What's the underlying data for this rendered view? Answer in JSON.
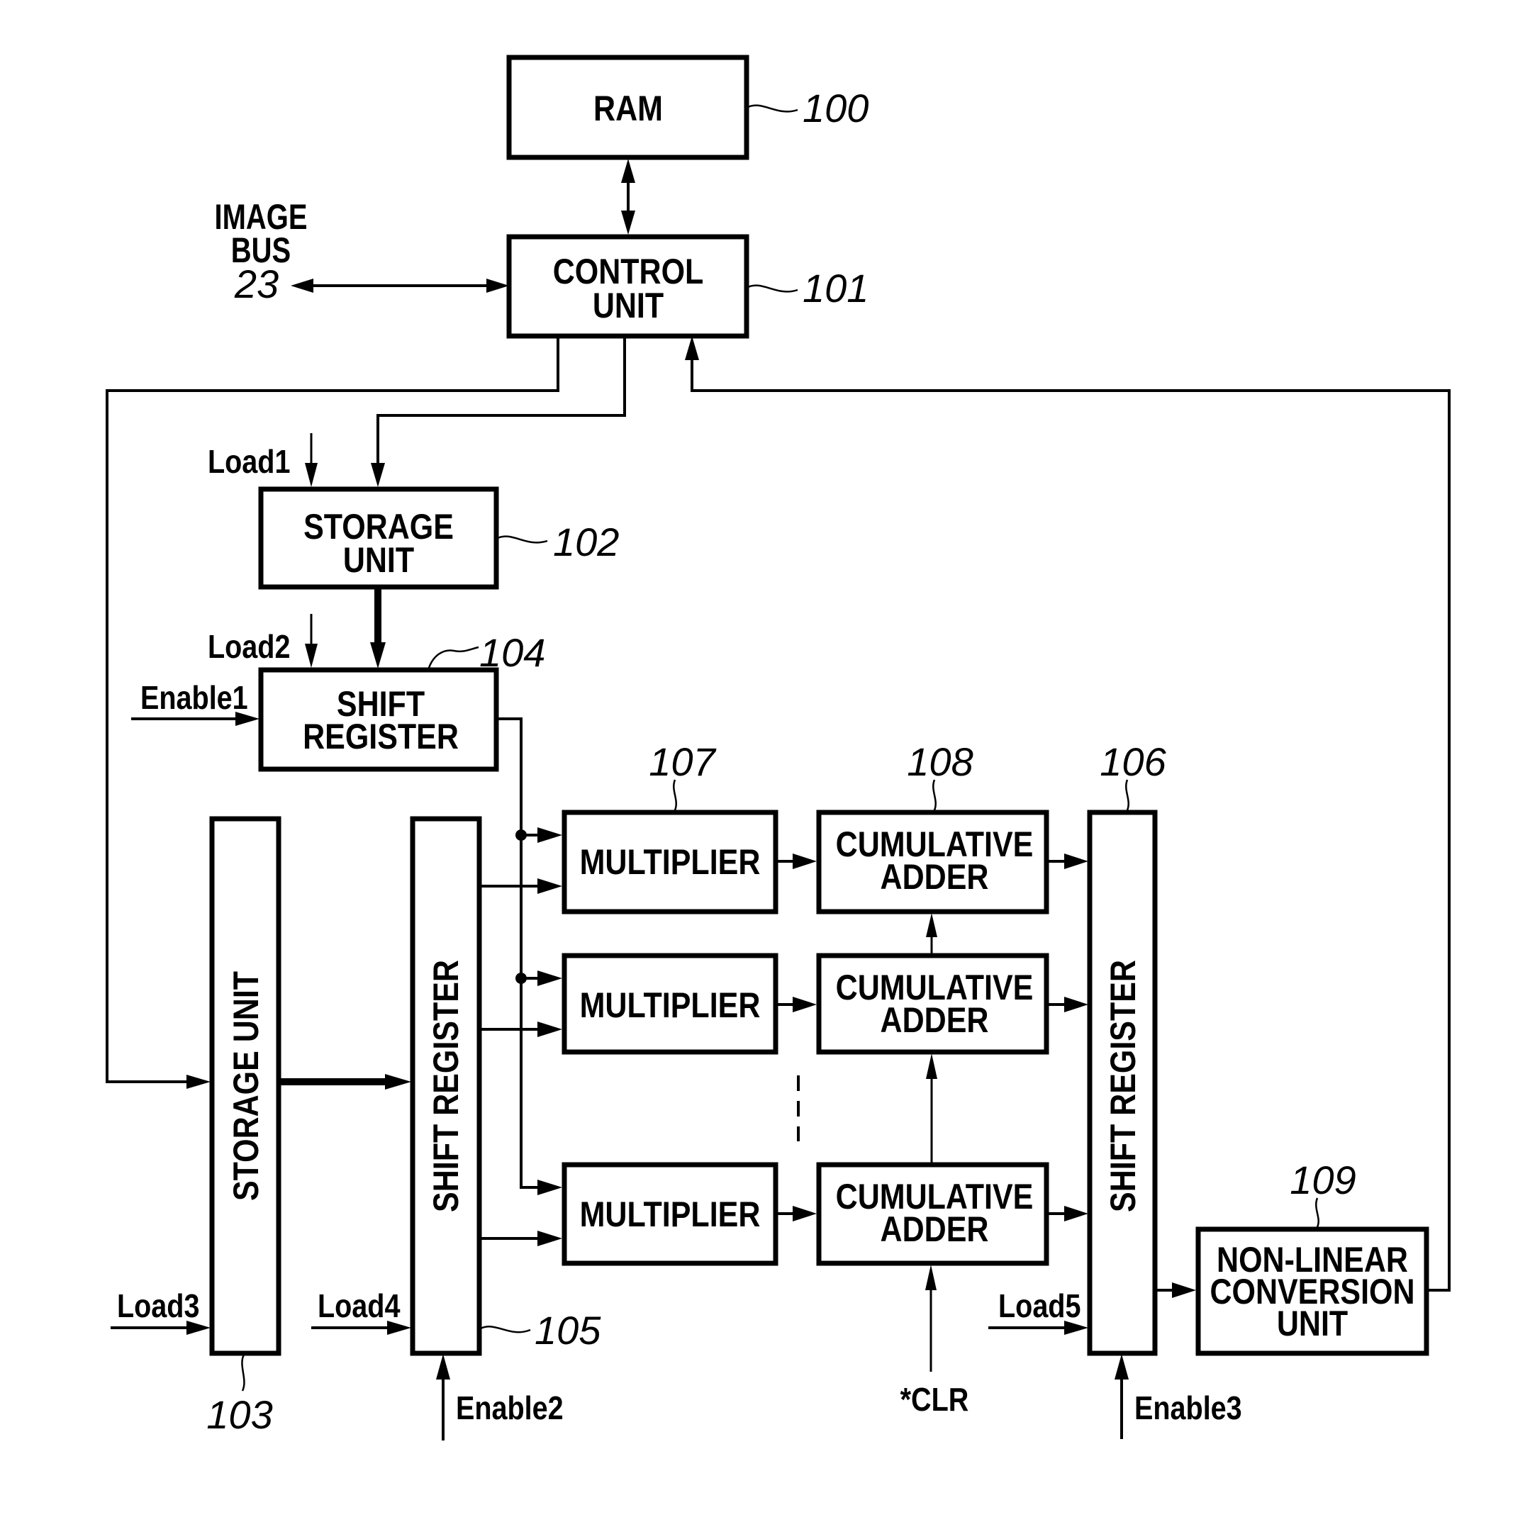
{
  "figure": {
    "blocks": {
      "ram": {
        "label": [
          "RAM"
        ],
        "ref": "100"
      },
      "control_unit": {
        "label": [
          "CONTROL",
          "UNIT"
        ],
        "ref": "101"
      },
      "storage_unit_102": {
        "label": [
          "STORAGE",
          "UNIT"
        ],
        "ref": "102"
      },
      "storage_unit_103": {
        "label": [
          "STORAGE UNIT"
        ],
        "ref": "103"
      },
      "shift_register_104": {
        "label": [
          "SHIFT",
          "REGISTER"
        ],
        "ref": "104"
      },
      "shift_register_105": {
        "label": [
          "SHIFT REGISTER"
        ],
        "ref": "105"
      },
      "shift_register_106": {
        "label": [
          "SHIFT REGISTER"
        ],
        "ref": "106"
      },
      "multiplier": {
        "label": [
          "MULTIPLIER"
        ],
        "ref": "107",
        "count_shown": 3
      },
      "cumulative_adder": {
        "label": [
          "CUMULATIVE",
          "ADDER"
        ],
        "ref": "108",
        "count_shown": 3
      },
      "nonlinear_conversion_unit": {
        "label": [
          "NON-LINEAR",
          "CONVERSION",
          "UNIT"
        ],
        "ref": "109"
      }
    },
    "image_bus": {
      "label": [
        "IMAGE",
        "BUS"
      ],
      "ref": "23"
    },
    "signals": {
      "load1": "Load1",
      "load2": "Load2",
      "load3": "Load3",
      "load4": "Load4",
      "load5": "Load5",
      "enable1": "Enable1",
      "enable2": "Enable2",
      "enable3": "Enable3",
      "clr": "*CLR"
    }
  }
}
